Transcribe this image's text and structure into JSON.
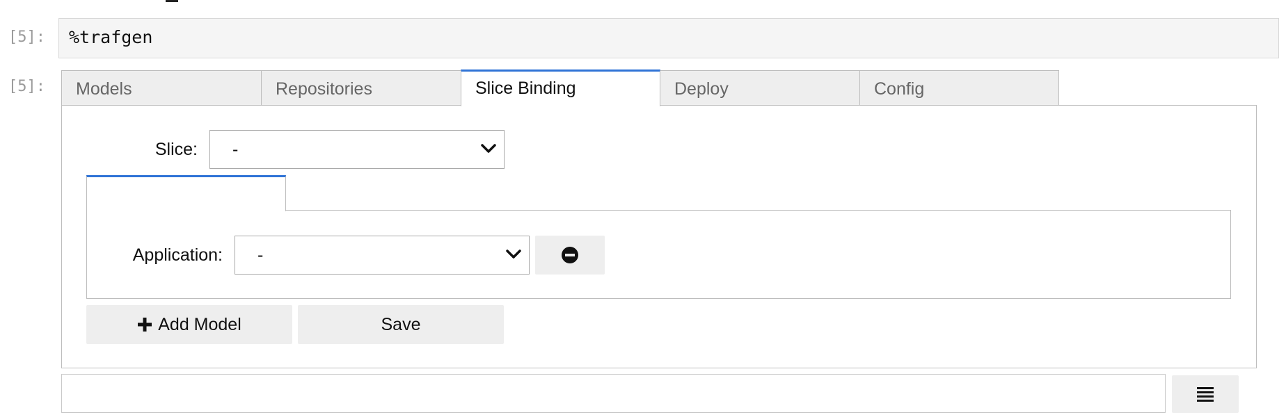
{
  "cells": {
    "input_prompt": "[5]:",
    "input_code": "%trafgen",
    "output_prompt": "[5]:"
  },
  "tabs": [
    {
      "label": "Models",
      "active": false
    },
    {
      "label": "Repositories",
      "active": false
    },
    {
      "label": "Slice Binding",
      "active": true
    },
    {
      "label": "Deploy",
      "active": false
    },
    {
      "label": "Config",
      "active": false
    }
  ],
  "slice": {
    "label": "Slice:",
    "value": "-"
  },
  "application": {
    "label": "Application:",
    "value": "-"
  },
  "buttons": {
    "add_model": "Add Model",
    "save": "Save"
  },
  "output": {
    "text_value": ""
  },
  "icons": {
    "remove": "minus-circle-icon",
    "add": "plus-icon",
    "menu": "list-lines-icon"
  },
  "colors": {
    "accent": "#2f73d6",
    "tab_inactive_bg": "#eeeeee",
    "input_bg": "#f5f5f5"
  }
}
